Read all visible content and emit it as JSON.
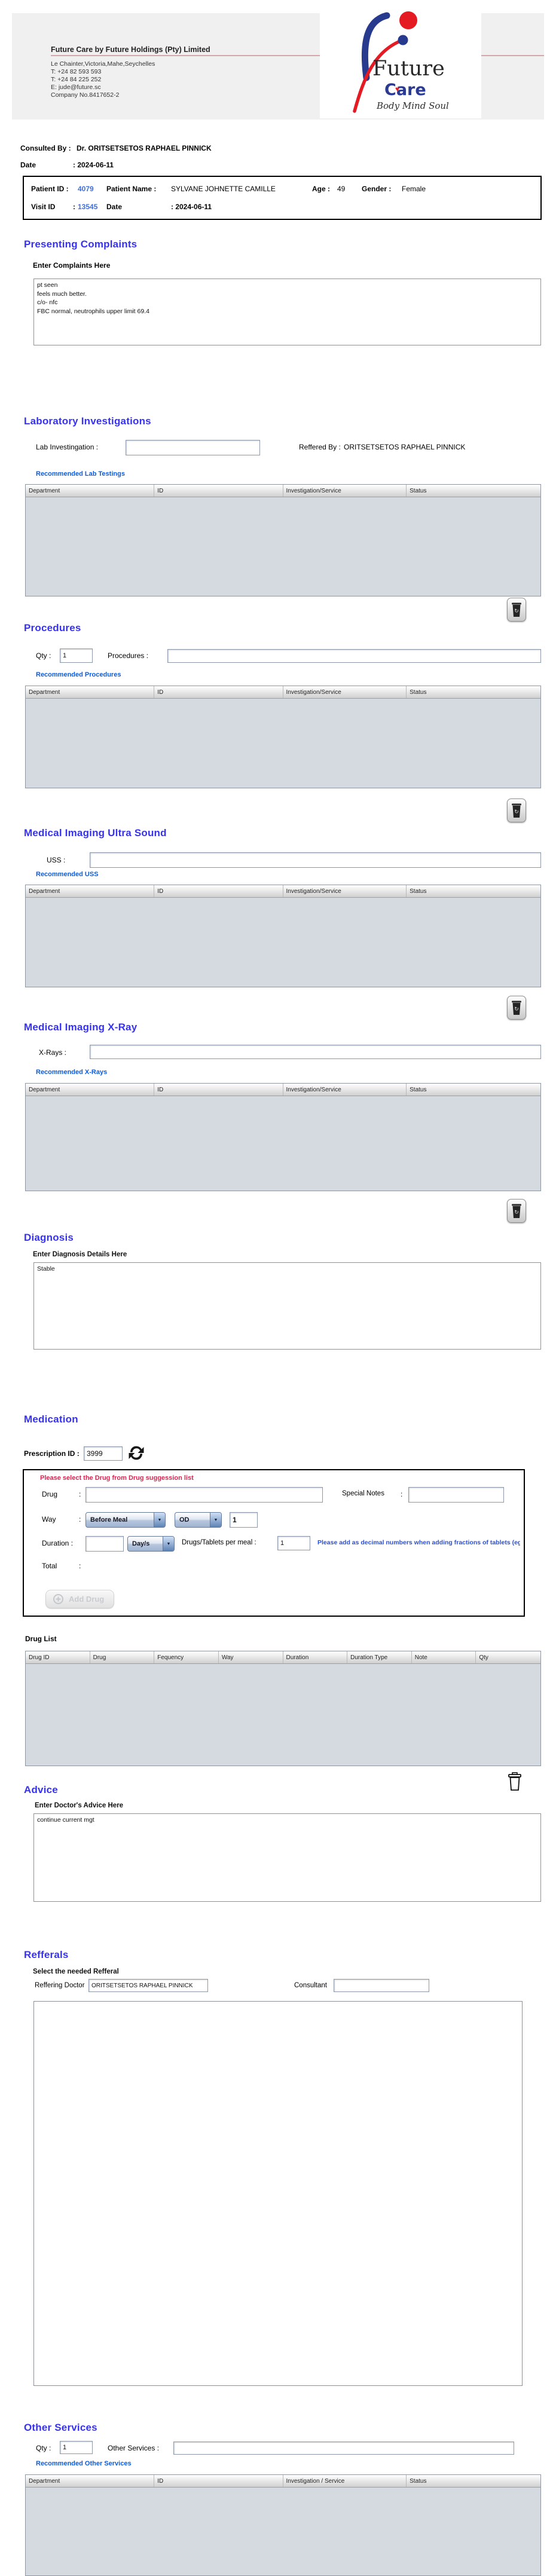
{
  "glyphs": {
    "colon": ":",
    "dropdown": "▼"
  },
  "colors": {
    "heading_blue": "#3632f0",
    "link_blue": "#0a5be0",
    "id_blue": "#3f6fdd",
    "warning_red": "#d8254f",
    "note_blue": "#2a4fd7",
    "table_body": "#d5d9e0"
  },
  "company": {
    "title": "Future Care by Future Holdings (Pty) Limited",
    "address_lines": [
      "Le Chainter,Victoria,Mahe,Seychelles",
      "T: +24  82 593 593",
      "T: +24  84 225 252",
      "E: jude@future.sc",
      "Company No.8417652-2"
    ],
    "logo": {
      "word1": "Future",
      "word2": "Care",
      "tagline": "Body Mind Soul"
    }
  },
  "consult": {
    "consulted_by_label": "Consulted By :",
    "consulted_by_value": "Dr.  ORITSETSETOS RAPHAEL PINNICK",
    "date_label": "Date",
    "date_value": ": 2024-06-11"
  },
  "patient": {
    "patient_id_label": "Patient ID :",
    "patient_id_value": "4079",
    "patient_name_label": "Patient Name :",
    "patient_name_value": "SYLVANE JOHNETTE CAMILLE",
    "age_label": "Age :",
    "age_value": "49",
    "gender_label": "Gender :",
    "gender_value": "Female",
    "visit_id_label": "Visit ID",
    "visit_id_value": "13545",
    "visit_date_label": "Date",
    "visit_date_value": ": 2024-06-11"
  },
  "complaints": {
    "title": "Presenting Complaints",
    "sublabel": "Enter Complaints Here",
    "text": "pt seen\nfeels much better.\nc/o- nfc\nFBC normal, neutrophils upper limit 69.4"
  },
  "lab": {
    "title": "Laboratory  Investigations",
    "field_label": "Lab Investingation :",
    "field_value": "",
    "referred_label": "Reffered By :",
    "referred_value": "ORITSETSETOS RAPHAEL PINNICK",
    "link": "Recommended Lab Testings",
    "headers": [
      "Department",
      "ID",
      "Investigation/Service",
      "Status"
    ]
  },
  "procedures": {
    "title": "Procedures",
    "qty_label": "Qty :",
    "qty_value": "1",
    "field_label": "Procedures :",
    "field_value": "",
    "link": "Recommended Procedures",
    "headers": [
      "Department",
      "ID",
      "Investigation/Service",
      "Status"
    ]
  },
  "uss": {
    "title": "Medical Imaging Ultra Sound",
    "field_label": "USS :",
    "field_value": "",
    "link": "Recommended USS",
    "headers": [
      "Department",
      "ID",
      "Investigation/Service",
      "Status"
    ]
  },
  "xray": {
    "title": "Medical Imaging X-Ray",
    "field_label": "X-Rays :",
    "field_value": "",
    "link": "Recommended X-Rays",
    "headers": [
      "Department",
      "ID",
      "Investigation/Service",
      "Status"
    ]
  },
  "diagnosis": {
    "title": "Diagnosis",
    "sublabel": "Enter Diagnosis Details Here",
    "text": "Stable"
  },
  "medication": {
    "title": "Medication",
    "prescription_label": "Prescription ID :",
    "prescription_value": "3999",
    "warning": "Please select the Drug from Drug suggession list",
    "drug_label": "Drug",
    "drug_value": "",
    "special_notes_label": "Special Notes",
    "special_notes_value": "",
    "way_label": "Way",
    "way_select": "Before Meal",
    "freq_select": "OD",
    "freq_qty_value": "1",
    "duration_label": "Duration :",
    "duration_value": "",
    "duration_unit_select": "Day/s",
    "per_meal_label": "Drugs/Tablets per meal :",
    "per_meal_value": "1",
    "note": "Please add as decimal numbers when adding fractions of tablets (eg",
    "total_label": "Total",
    "add_button": "Add Drug",
    "list_label": "Drug List",
    "headers": [
      "Drug ID",
      "Drug",
      "Fequency",
      "Way",
      "Duration",
      "Duration Type",
      "Note",
      "Qty"
    ]
  },
  "advice": {
    "title": "Advice",
    "sublabel": "Enter Doctor's Advice Here",
    "text": "continue current mgt"
  },
  "referrals": {
    "title": "Refferals",
    "sublabel": "Select the needed Refferal",
    "doctor_label": "Reffering Doctor",
    "doctor_value": "ORITSETSETOS RAPHAEL PINNICK",
    "consultant_label": "Consultant",
    "consultant_value": ""
  },
  "other": {
    "title": "Other Services",
    "qty_label": "Qty :",
    "qty_value": "1",
    "field_label": "Other Services :",
    "field_value": "",
    "link": "Recommended Other Services",
    "headers": [
      "Department",
      "ID",
      "Investigation / Service",
      "Status"
    ]
  }
}
